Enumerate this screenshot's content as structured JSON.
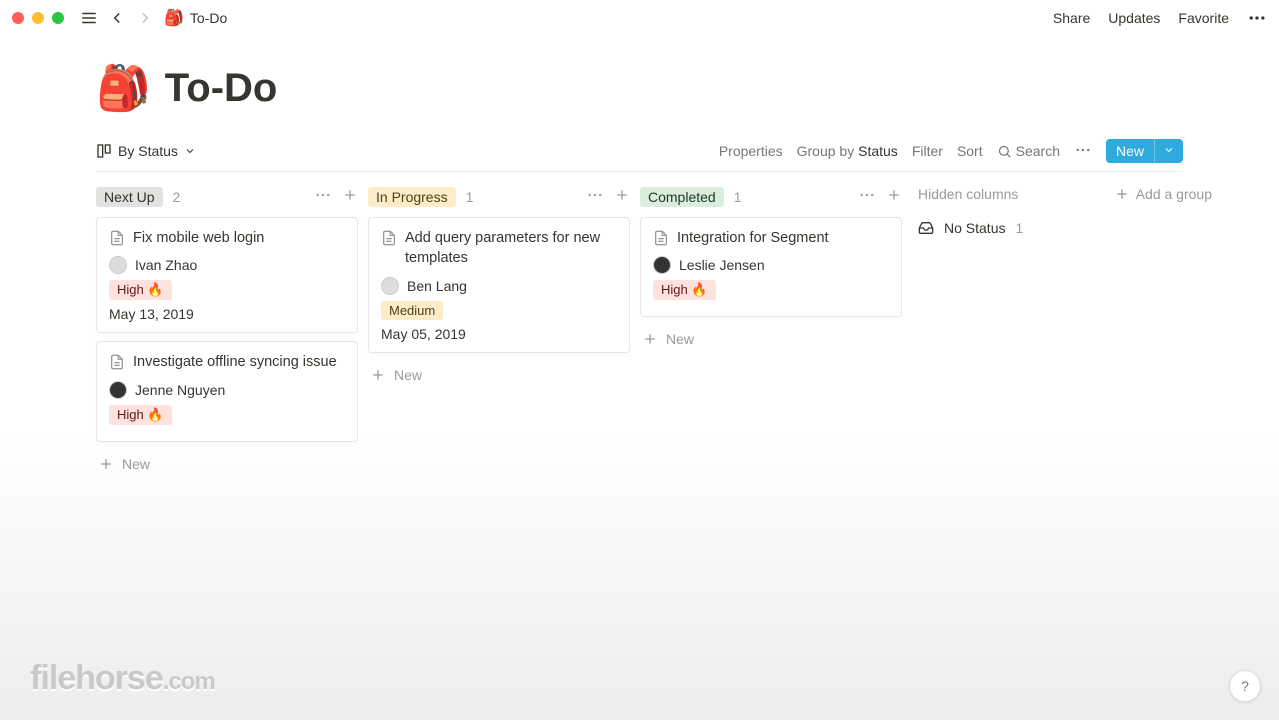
{
  "window": {
    "breadcrumb_emoji": "🎒",
    "breadcrumb_title": "To-Do",
    "actions": {
      "share": "Share",
      "updates": "Updates",
      "favorite": "Favorite"
    }
  },
  "page": {
    "emoji": "🎒",
    "title": "To-Do"
  },
  "viewbar": {
    "view_name": "By Status",
    "properties": "Properties",
    "group_by_prefix": "Group by ",
    "group_by_value": "Status",
    "filter": "Filter",
    "sort": "Sort",
    "search": "Search",
    "new_btn": "New"
  },
  "board": {
    "columns": [
      {
        "name": "Next Up",
        "count": "2",
        "tag_class": "tag-nextup",
        "cards": [
          {
            "title": "Fix mobile web login",
            "assignee": "Ivan Zhao",
            "avatar": "light",
            "priority": "High 🔥",
            "prio_class": "prio-high",
            "date": "May 13, 2019"
          },
          {
            "title": "Investigate offline syncing issue",
            "assignee": "Jenne Nguyen",
            "avatar": "dark",
            "priority": "High 🔥",
            "prio_class": "prio-high"
          }
        ],
        "new": "New"
      },
      {
        "name": "In Progress",
        "count": "1",
        "tag_class": "tag-inprog",
        "cards": [
          {
            "title": "Add query parameters for new templates",
            "assignee": "Ben Lang",
            "avatar": "light",
            "priority": "Medium",
            "prio_class": "prio-medium",
            "date": "May 05, 2019"
          }
        ],
        "new": "New"
      },
      {
        "name": "Completed",
        "count": "1",
        "tag_class": "tag-completed",
        "cards": [
          {
            "title": "Integration for Segment",
            "assignee": "Leslie Jensen",
            "avatar": "dark",
            "priority": "High 🔥",
            "prio_class": "prio-high"
          }
        ],
        "new": "New"
      }
    ],
    "hidden_label": "Hidden columns",
    "add_group": "Add a group",
    "no_status": {
      "label": "No Status",
      "count": "1"
    }
  },
  "help": "?",
  "watermark": {
    "a": "filehorse",
    "b": ".com"
  }
}
